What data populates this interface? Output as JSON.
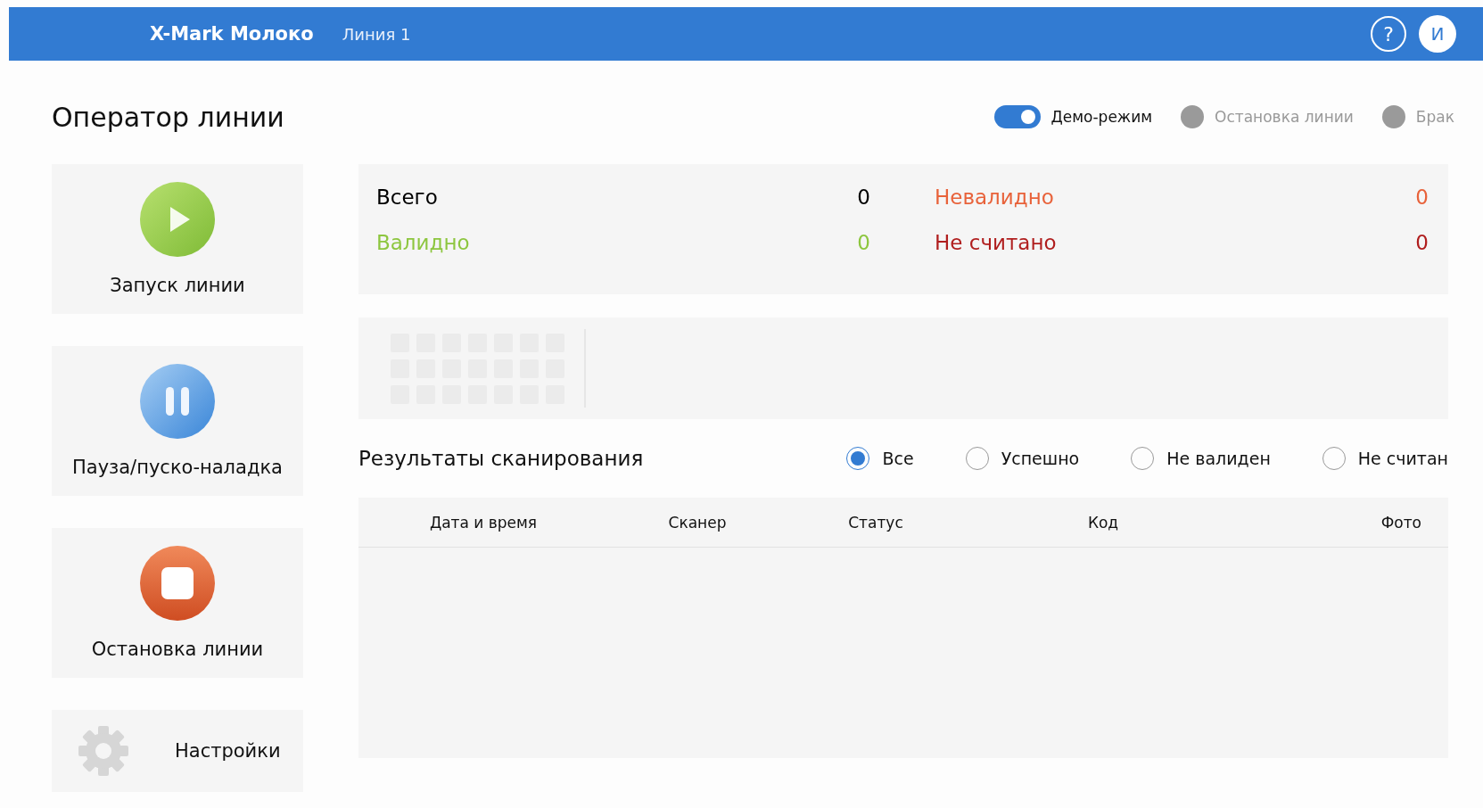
{
  "header": {
    "brand": "X-Mark Молоко",
    "line": "Линия 1",
    "help": "?",
    "avatar": "И"
  },
  "page_title": "Оператор линии",
  "indicators": [
    {
      "kind": "toggle",
      "label": "Демо-режим",
      "on": true
    },
    {
      "kind": "lamp",
      "label": "Остановка линии",
      "on": false
    },
    {
      "kind": "lamp",
      "label": "Брак",
      "on": false
    }
  ],
  "actions": [
    {
      "kind": "start",
      "label": "Запуск линии"
    },
    {
      "kind": "pause",
      "label": "Пауза/пуско-наладка"
    },
    {
      "kind": "stop",
      "label": "Остановка линии"
    },
    {
      "kind": "settings",
      "label": "Настройки"
    }
  ],
  "stats": [
    {
      "label": "Всего",
      "value": "0",
      "color": "#000000"
    },
    {
      "label": "Невалидно",
      "value": "0",
      "color": "#e8623a"
    },
    {
      "label": "Валидно",
      "value": "0",
      "color": "#8dc63f"
    },
    {
      "label": "Не считано",
      "value": "0",
      "color": "#b01e1e"
    }
  ],
  "results": {
    "title": "Результаты сканирования",
    "filters": [
      {
        "label": "Все",
        "selected": true
      },
      {
        "label": "Успешно",
        "selected": false
      },
      {
        "label": "Не валиден",
        "selected": false
      },
      {
        "label": "Не считан",
        "selected": false
      }
    ],
    "columns": [
      "Дата и время",
      "Сканер",
      "Статус",
      "Код",
      "Фото"
    ]
  }
}
